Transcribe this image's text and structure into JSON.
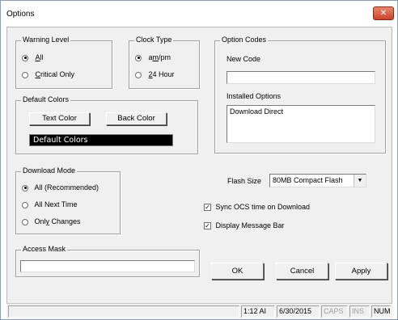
{
  "window": {
    "title": "Options",
    "close_glyph": "✕"
  },
  "warning_level": {
    "legend": "Warning Level",
    "options": [
      {
        "label": "All",
        "accel": "A",
        "rest": "ll",
        "selected": true
      },
      {
        "label": "Critical Only",
        "accel": "C",
        "rest": "ritical Only",
        "selected": false
      }
    ]
  },
  "clock_type": {
    "legend": "Clock Type",
    "options": [
      {
        "label": "am/pm",
        "accel": "m",
        "pre": "a",
        "rest": "/pm",
        "selected": true
      },
      {
        "label": "24 Hour",
        "accel": "2",
        "rest": "4 Hour",
        "selected": false
      }
    ]
  },
  "option_codes": {
    "legend": "Option Codes",
    "new_code_label": "New Code",
    "new_code_value": "",
    "installed_label": "Installed Options",
    "installed_items": [
      "Download Direct"
    ]
  },
  "default_colors": {
    "legend": "Default Colors",
    "text_color_button": "Text Color",
    "back_color_button": "Back Color",
    "preview_text": "Default Colors",
    "preview_bg": "#000000",
    "preview_fg": "#ffffff"
  },
  "download_mode": {
    "legend": "Download Mode",
    "options": [
      {
        "label": "All (Recommended)",
        "selected": true
      },
      {
        "label": "All Next Time",
        "selected": false
      },
      {
        "label": "Only Changes",
        "accel": "y",
        "pre": "Onl",
        "rest": " Changes",
        "selected": false
      }
    ]
  },
  "flash_size": {
    "label": "Flash Size",
    "selected": "80MB Compact Flash",
    "arrow": "▼"
  },
  "checkboxes": {
    "sync_ocs": {
      "label": "Sync OCS time on Download",
      "checked": true
    },
    "display_message_bar": {
      "label": "Display Message Bar",
      "checked": true
    },
    "check_glyph": "✓"
  },
  "access_mask": {
    "legend": "Access Mask",
    "value": ""
  },
  "buttons": {
    "ok": "OK",
    "cancel": "Cancel",
    "apply": "Apply"
  },
  "statusbar": {
    "time": "1:12 AI",
    "date": "6/30/2015",
    "caps": "CAPS",
    "ins": "INS",
    "num": "NUM"
  },
  "colors": {
    "accent_close": "#c7432b",
    "panel_bg": "#f0f0f0"
  }
}
